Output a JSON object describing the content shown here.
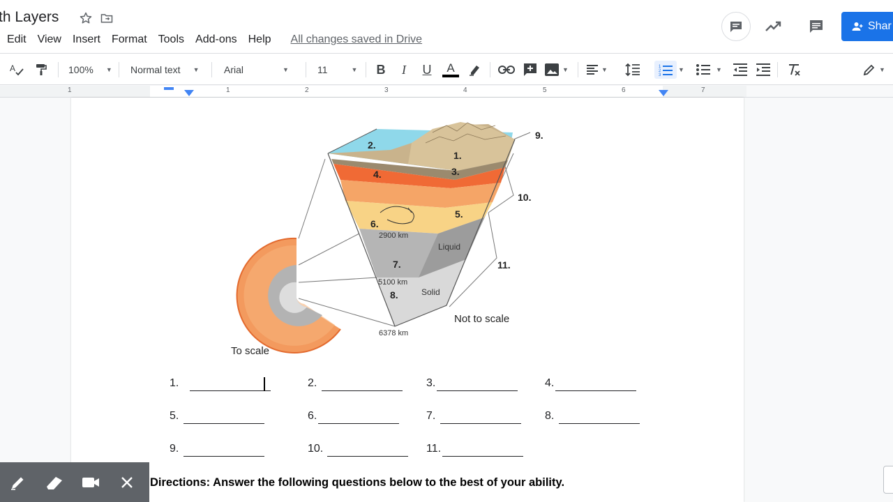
{
  "header": {
    "doc_title": "th Layers",
    "menu": [
      "Edit",
      "View",
      "Insert",
      "Format",
      "Tools",
      "Add-ons",
      "Help"
    ],
    "saved_status": "All changes saved in Drive",
    "share_label": "Shar"
  },
  "toolbar": {
    "zoom": "100%",
    "style": "Normal text",
    "font": "Arial",
    "font_size": "11",
    "text_color": "#000000"
  },
  "ruler": {
    "labels": [
      "1",
      "1",
      "2",
      "3",
      "4",
      "5",
      "6",
      "7"
    ]
  },
  "diagram": {
    "labels": {
      "n1": "1.",
      "n2": "2.",
      "n3": "3.",
      "n4": "4.",
      "n5": "5.",
      "n6": "6.",
      "n7": "7.",
      "n8": "8.",
      "n9": "9.",
      "n10": "10.",
      "n11": "11."
    },
    "depth_2900": "2900 km",
    "depth_5100": "5100 km",
    "depth_6378": "6378 km",
    "liquid": "Liquid",
    "solid": "Solid",
    "not_to_scale": "Not to scale",
    "to_scale": "To scale"
  },
  "answers": {
    "rows": [
      [
        {
          "num": "1."
        },
        {
          "num": "2."
        },
        {
          "num": "3."
        },
        {
          "num": "4."
        }
      ],
      [
        {
          "num": "5."
        },
        {
          "num": "6."
        },
        {
          "num": "7."
        },
        {
          "num": "8."
        }
      ],
      [
        {
          "num": "9."
        },
        {
          "num": "10."
        },
        {
          "num": "11."
        }
      ]
    ]
  },
  "directions": "Directions: Answer the following questions below to the best of your ability.",
  "colors": {
    "accent": "#1a73e8",
    "ocean": "#7fd4e6",
    "crust": "#c8b08a",
    "upper_mantle": "#f07a3a",
    "mantle": "#f5a25e",
    "lower_mantle": "#f7d07a",
    "outer_core": "#b4b4b4",
    "inner_core": "#d8d8d8"
  }
}
